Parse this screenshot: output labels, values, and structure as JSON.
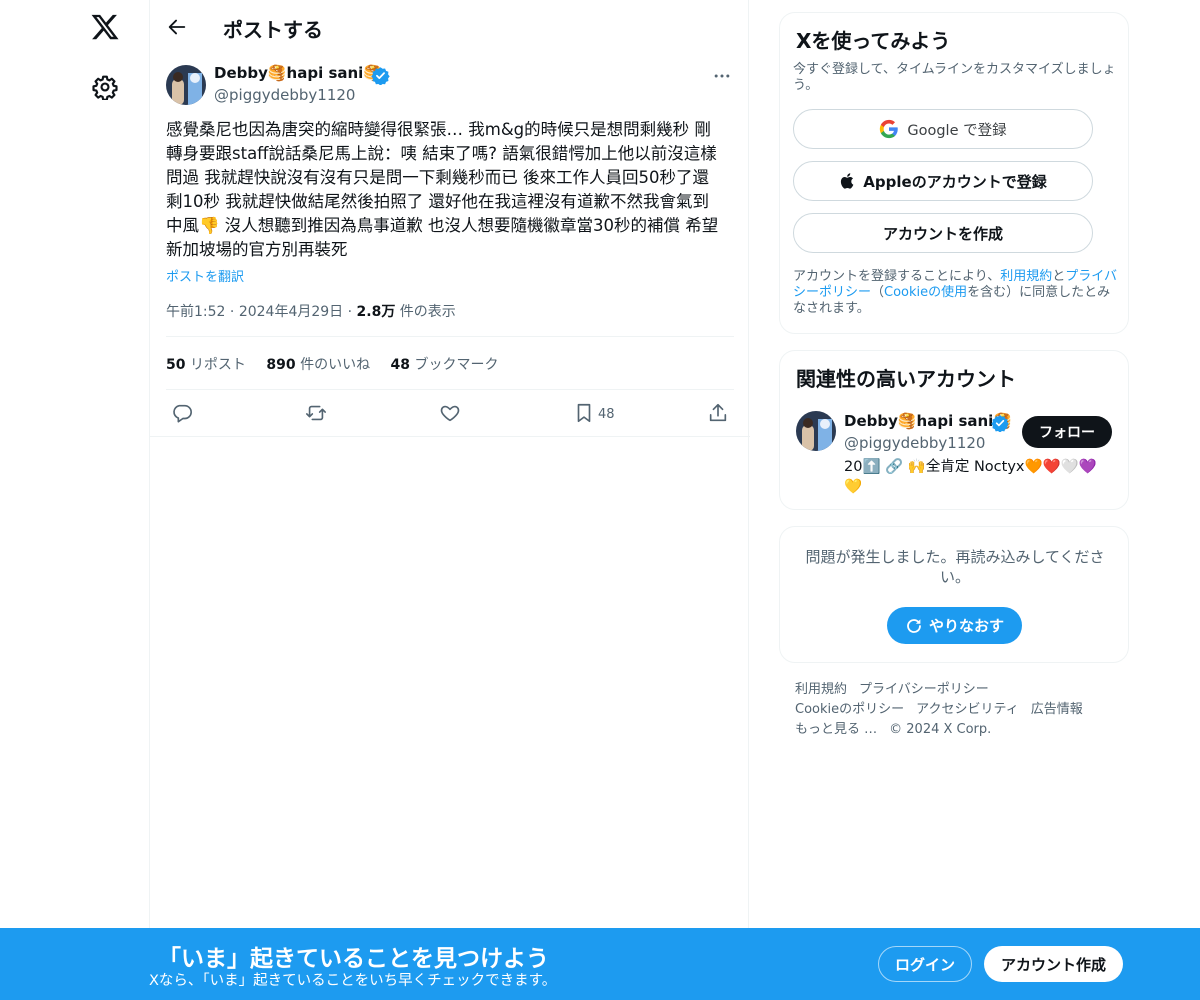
{
  "header": {
    "title": "ポストする"
  },
  "post": {
    "author_name": "Debby🥞hapi sani🥞",
    "handle": "@piggydebby1120",
    "text": "感覺桑尼也因為唐突的縮時變得很緊張… 我m&g的時候只是想問剩幾秒 剛\n轉身要跟staff說話桑尼馬上說：咦 結束了嗎? 語氣很錯愕加上他以前沒這樣\n問過 我就趕快說沒有沒有只是問一下剩幾秒而已 後來工作人員回50秒了還\n剩10秒 我就趕快做結尾然後拍照了 還好他在我這裡沒有道歉不然我會氣到\n中風👎 沒人想聽到推因為鳥事道歉 也沒人想要隨機徽章當30秒的補償 希望\n新加坡場的官方別再裝死",
    "translate_label": "ポストを翻訳",
    "time": "午前1:52",
    "date": "2024年4月29日",
    "views_count": "2.8万",
    "views_label": "件の表示",
    "sep": "·",
    "stats": {
      "reposts_count": "50",
      "reposts_label": "リポスト",
      "likes_count": "890",
      "likes_label": "件のいいね",
      "bookmarks_count": "48",
      "bookmarks_label": "ブックマーク"
    },
    "bookmark_action_count": "48"
  },
  "signup": {
    "title": "Xを使ってみよう",
    "subtitle": "今すぐ登録して、タイムラインをカスタマイズしましょう。",
    "google_label": "Google で登録",
    "apple_label": "Appleのアカウントで登録",
    "create_label": "アカウントを作成",
    "legal_prefix": "アカウントを登録することにより、",
    "legal_terms": "利用規約",
    "legal_and": "と",
    "legal_privacy": "プライバシーポリシー",
    "legal_open": "（",
    "legal_cookie": "Cookieの使用",
    "legal_suffix": "を含む）に同意したとみなされます。"
  },
  "related": {
    "title": "関連性の高いアカウント",
    "name": "Debby🥞hapi sani🥞",
    "handle": "@piggydebby1120",
    "follow_label": "フォロー",
    "bio": "20⬆️ 🔗 🙌全肯定 Noctyx🧡❤️🤍💜💛"
  },
  "error": {
    "text": "問題が発生しました。再読み込みしてください。",
    "retry_label": "やりなおす"
  },
  "footer": {
    "links": [
      "利用規約",
      "プライバシーポリシー",
      "Cookieのポリシー",
      "アクセシビリティ",
      "広告情報",
      "もっと見る …",
      "© 2024 X Corp."
    ]
  },
  "bottom_bar": {
    "title": "「いま」起きていることを見つけよう",
    "subtitle": "Xなら、「いま」起きていることをいち早くチェックできます。",
    "login_label": "ログイン",
    "signup_label": "アカウント作成"
  },
  "colors": {
    "accent": "#1d9bf0",
    "text": "#0f1419",
    "muted": "#536471",
    "border": "#eff3f4"
  }
}
